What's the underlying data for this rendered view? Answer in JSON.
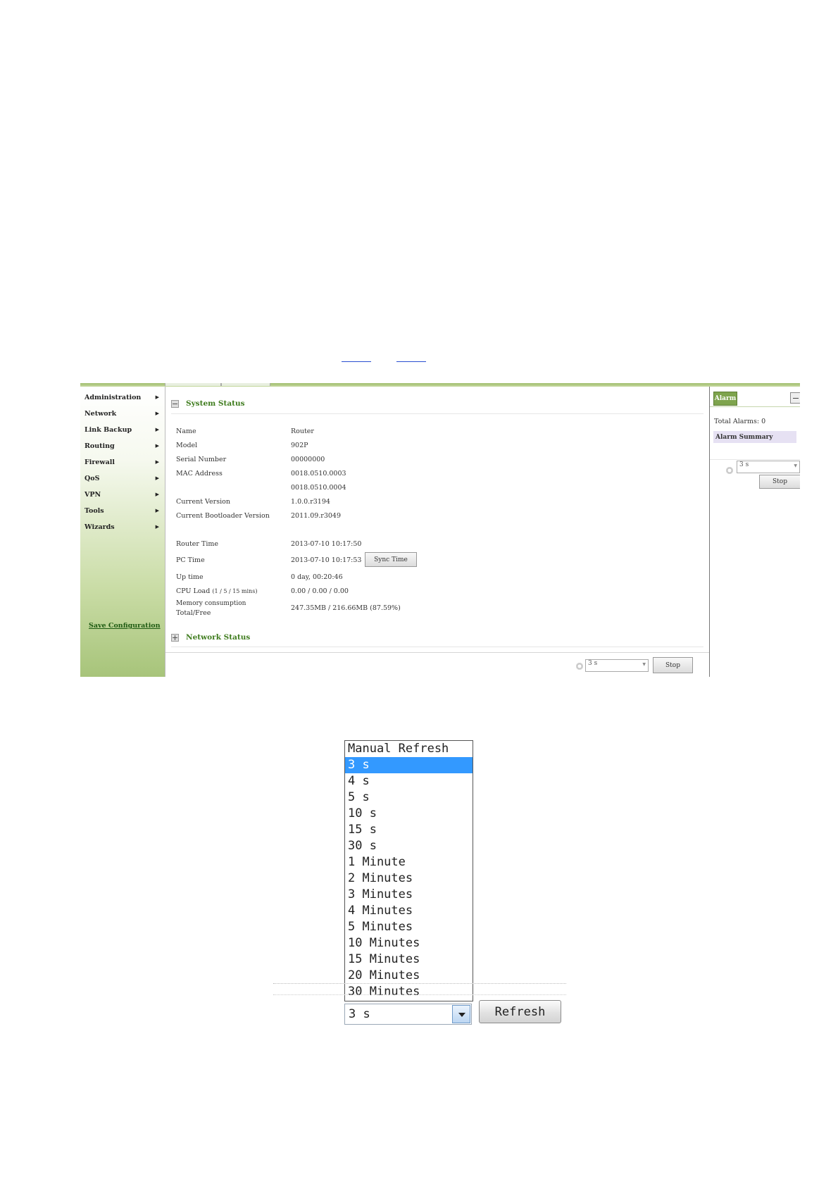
{
  "sidebar": {
    "items": [
      {
        "label": "Administration"
      },
      {
        "label": "Network"
      },
      {
        "label": "Link Backup"
      },
      {
        "label": "Routing"
      },
      {
        "label": "Firewall"
      },
      {
        "label": "QoS"
      },
      {
        "label": "VPN"
      },
      {
        "label": "Tools"
      },
      {
        "label": "Wizards"
      }
    ],
    "arrow": "▶",
    "save_label": "Save Configuration"
  },
  "system_status": {
    "title": "System Status",
    "rows": {
      "name": {
        "label": "Name",
        "value": "Router"
      },
      "model": {
        "label": "Model",
        "value": "902P"
      },
      "serial": {
        "label": "Serial Number",
        "value": "00000000"
      },
      "mac": {
        "label": "MAC Address",
        "value": "0018.0510.0003",
        "value2": "0018.0510.0004"
      },
      "current_version": {
        "label": "Current Version",
        "value": "1.0.0.r3194"
      },
      "bootloader": {
        "label": "Current Bootloader Version",
        "value": "2011.09.r3049"
      },
      "router_time": {
        "label": "Router Time",
        "value": "2013-07-10 10:17:50"
      },
      "pc_time": {
        "label": "PC Time",
        "value": "2013-07-10 10:17:53"
      },
      "uptime": {
        "label": "Up time",
        "value": "0 day, 00:20:46"
      },
      "cpu": {
        "label": "CPU Load",
        "label_small": "(1 / 5 / 15 mins)",
        "value": "0.00 / 0.00 / 0.00"
      },
      "memory": {
        "label": "Memory consumption",
        "label2": "Total/Free",
        "value": "247.35MB / 216.66MB (87.59%)"
      }
    },
    "sync_label": "Sync Time"
  },
  "network_status": {
    "title": "Network Status"
  },
  "footer": {
    "interval": "3 s",
    "stop_label": "Stop"
  },
  "alarm": {
    "tab": "Alarm",
    "total": "Total Alarms: 0",
    "summary": "Alarm Summary",
    "interval": "3 s",
    "stop_label": "Stop"
  },
  "refresh_dropdown": {
    "options": [
      "Manual Refresh",
      "3 s",
      "4 s",
      "5 s",
      "10 s",
      "15 s",
      "30 s",
      "1 Minute",
      "2 Minutes",
      "3 Minutes",
      "4 Minutes",
      "5 Minutes",
      "10 Minutes",
      "15 Minutes",
      "20 Minutes",
      "30 Minutes"
    ],
    "selected_index": 1,
    "current": "3 s",
    "refresh_label": "Refresh"
  }
}
